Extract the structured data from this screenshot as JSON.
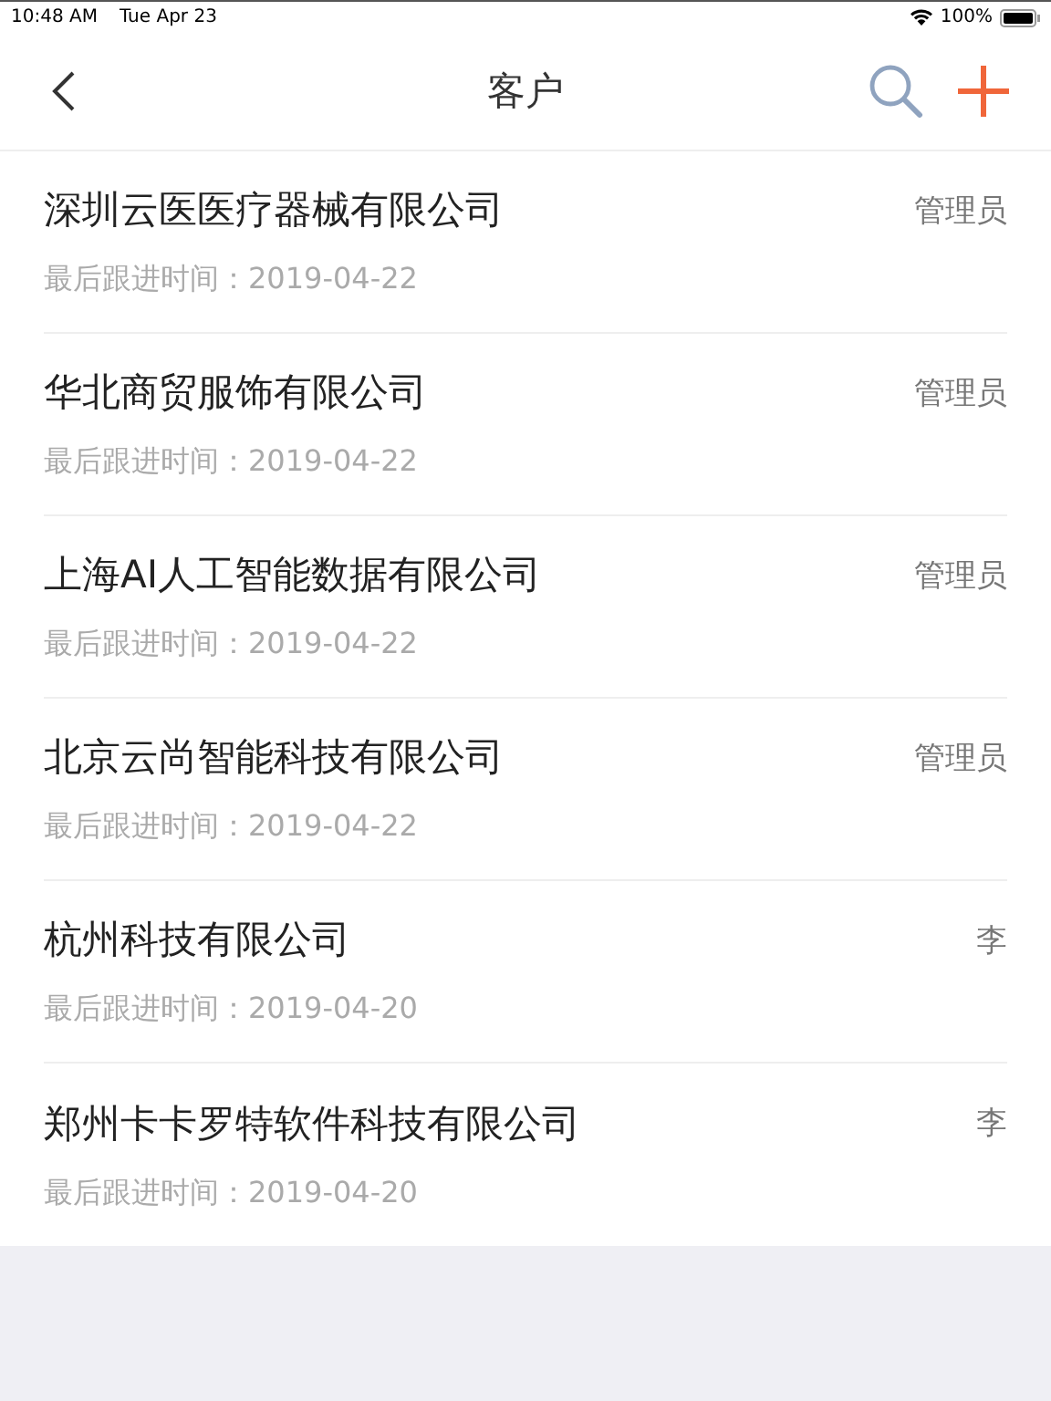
{
  "status_bar": {
    "time": "10:48 AM",
    "date": "Tue Apr 23",
    "battery": "100%"
  },
  "nav": {
    "title": "客户"
  },
  "customers": [
    {
      "name": "深圳云医医疗器械有限公司",
      "owner": "管理员",
      "last_follow_up": "最后跟进时间：2019-04-22"
    },
    {
      "name": "华北商贸服饰有限公司",
      "owner": "管理员",
      "last_follow_up": "最后跟进时间：2019-04-22"
    },
    {
      "name": "上海AI人工智能数据有限公司",
      "owner": "管理员",
      "last_follow_up": "最后跟进时间：2019-04-22"
    },
    {
      "name": "北京云尚智能科技有限公司",
      "owner": "管理员",
      "last_follow_up": "最后跟进时间：2019-04-22"
    },
    {
      "name": "杭州科技有限公司",
      "owner": "李",
      "last_follow_up": "最后跟进时间：2019-04-20"
    },
    {
      "name": "郑州卡卡罗特软件科技有限公司",
      "owner": "李",
      "last_follow_up": "最后跟进时间：2019-04-20"
    }
  ]
}
